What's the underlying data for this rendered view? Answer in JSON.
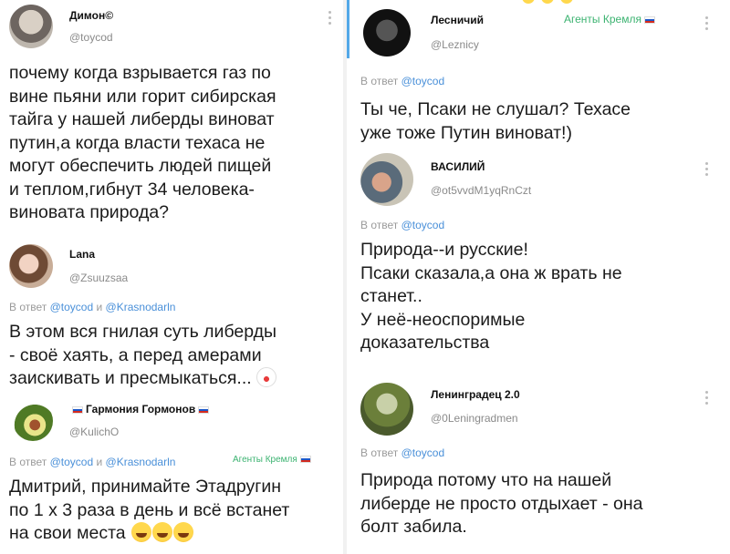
{
  "thread": {
    "reply_prefix": "В ответ",
    "agent_badge": "Агенты Кремля"
  },
  "left": [
    {
      "name": "Димон©",
      "handle": "@toycod",
      "reply_to": "",
      "text": "почему когда взрывается газ по\nвине пьяни или горит сибирская\nтайга у нашей либерды виноват\nпутин,а когда власти техаса не\nмогут обеспечить людей пищей\nи теплом,гибнут 34 человека-\nвиновата природа?"
    },
    {
      "name": "Lana",
      "handle": "@Zsuuzsaa",
      "reply_to_1": "@toycod",
      "reply_and": "и",
      "reply_to_2": "@Krasnodarln",
      "text": "В этом вся гнилая суть либерды\n-  своё хаять, а перед амерами\nзаискивать и пресмыкаться..."
    },
    {
      "name": "Гармония Гормонов",
      "handle": "@KulichO",
      "reply_to_1": "@toycod",
      "reply_and": "и",
      "reply_to_2": "@Krasnodarln",
      "text": "Дмитрий, принимайте Этадругин\nпо 1 х 3 раза в день и всё встанет\nна свои места"
    }
  ],
  "right": [
    {
      "name": "Лесничий",
      "handle": "@Leznicy",
      "reply_to_1": "@toycod",
      "text": "Ты че, Псаки не слушал? Техасе\nуже тоже Путин виноват!)"
    },
    {
      "name": "ВАСИЛИЙ",
      "handle": "@ot5vvdM1yqRnCzt",
      "reply_to_1": "@toycod",
      "text": "Природа--и русские!\nПсаки сказала,а она ж врать не\nстанет..\nУ неё-неоспоримые\nдоказательства"
    },
    {
      "name": "Ленинградец 2.0",
      "handle": "@0Leningradmen",
      "reply_to_1": "@toycod",
      "text": "Природа потому что на нашей\nлиберде не просто отдыхает - она\nболт забила."
    }
  ],
  "colors": {
    "accent_blue": "#4a90d9",
    "thread_bar": "#53a8e8",
    "agent_green": "#3cb371",
    "muted": "#8a8a8a"
  }
}
